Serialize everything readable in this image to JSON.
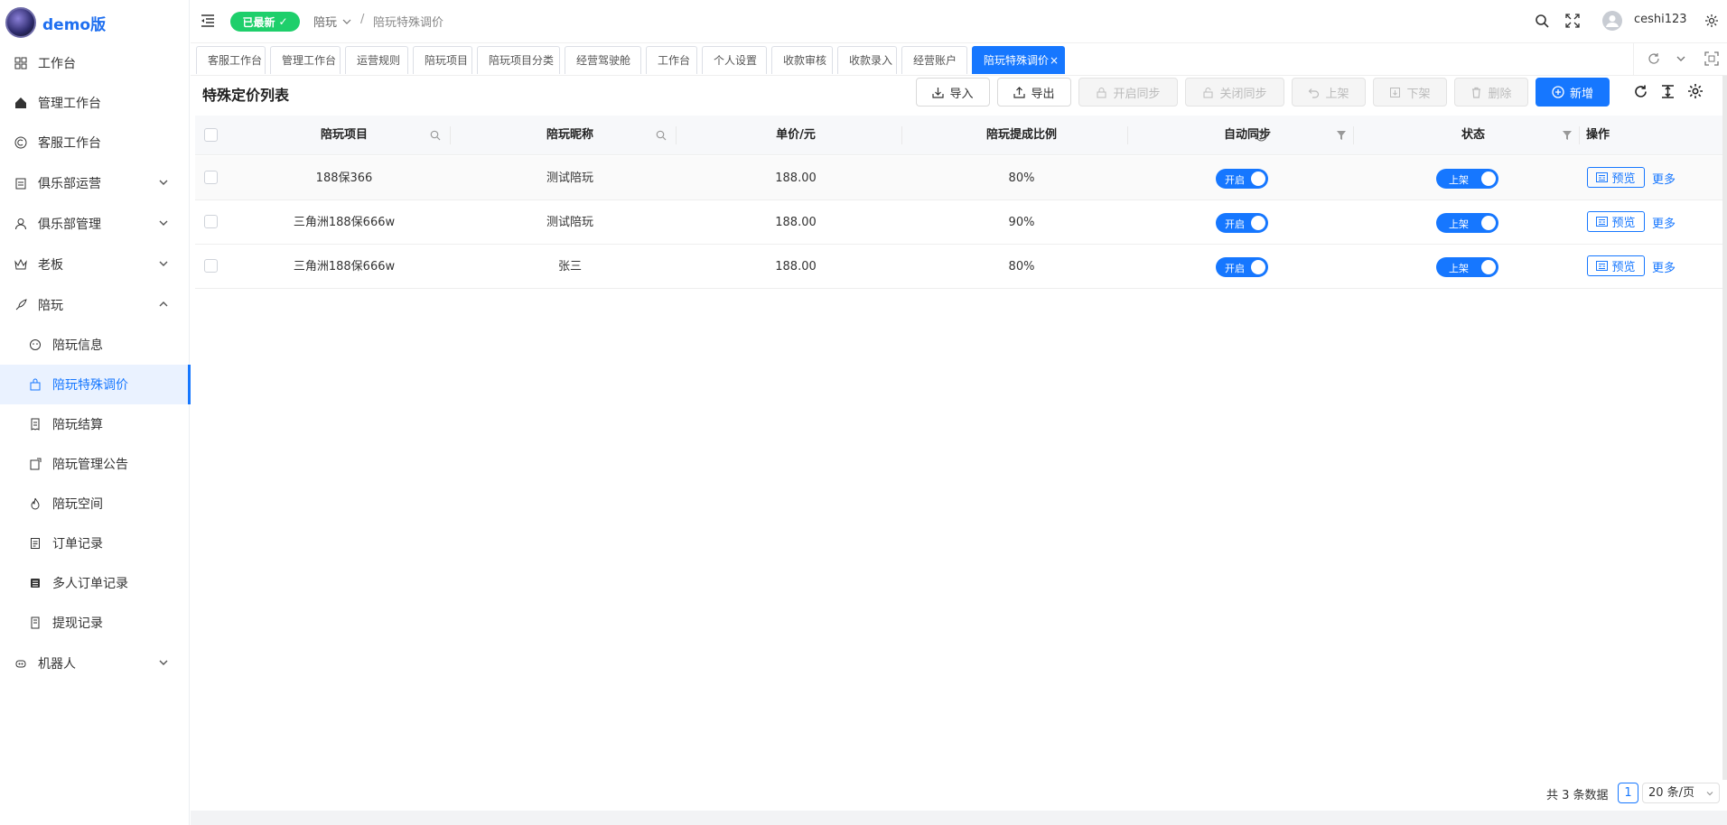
{
  "brand": "demo版",
  "sidebar": {
    "items": [
      {
        "label": "工作台",
        "icon": "dashboard-grid-icon"
      },
      {
        "label": "管理工作台",
        "icon": "home-icon"
      },
      {
        "label": "客服工作台",
        "icon": "copyright-icon"
      },
      {
        "label": "俱乐部运营",
        "icon": "calendar-icon"
      },
      {
        "label": "俱乐部管理",
        "icon": "user-icon"
      },
      {
        "label": "老板",
        "icon": "crown-icon"
      },
      {
        "label": "陪玩",
        "icon": "rocket-icon"
      },
      {
        "label": "陪玩信息",
        "icon": "smile-icon"
      },
      {
        "label": "陪玩特殊调价",
        "icon": "bag-icon"
      },
      {
        "label": "陪玩结算",
        "icon": "receipt-icon"
      },
      {
        "label": "陪玩管理公告",
        "icon": "notice-icon"
      },
      {
        "label": "陪玩空间",
        "icon": "fire-icon"
      },
      {
        "label": "订单记录",
        "icon": "document-icon"
      },
      {
        "label": "多人订单记录",
        "icon": "list-icon"
      },
      {
        "label": "提现记录",
        "icon": "withdraw-icon"
      },
      {
        "label": "机器人",
        "icon": "robot-icon"
      }
    ]
  },
  "header": {
    "badge": "已最新",
    "breadcrumb": [
      "陪玩",
      "/",
      "陪玩特殊调价"
    ],
    "username": "ceshi123"
  },
  "tabs": [
    "客服工作台",
    "管理工作台",
    "运营规则",
    "陪玩项目",
    "陪玩项目分类",
    "经营驾驶舱",
    "工作台",
    "个人设置",
    "收款审核",
    "收款录入",
    "经营账户",
    "陪玩特殊调价"
  ],
  "page": {
    "title": "特殊定价列表"
  },
  "toolbar": {
    "import": "导入",
    "export": "导出",
    "enable_sync": "开启同步",
    "disable_sync": "关闭同步",
    "shelve": "上架",
    "unshelve": "下架",
    "delete": "删除",
    "add": "新增"
  },
  "table": {
    "headers": [
      "陪玩项目",
      "陪玩昵称",
      "单价/元",
      "陪玩提成比例",
      "自动同步",
      "状态",
      "操作"
    ],
    "rows": [
      {
        "item": "188保366",
        "nickname": "测试陪玩",
        "price": "188.00",
        "ratio": "80%",
        "sync": "开启",
        "status": "上架",
        "preview": "预览",
        "more": "更多"
      },
      {
        "item": "三角洲188保666w",
        "nickname": "测试陪玩",
        "price": "188.00",
        "ratio": "90%",
        "sync": "开启",
        "status": "上架",
        "preview": "预览",
        "more": "更多"
      },
      {
        "item": "三角洲188保666w",
        "nickname": "张三",
        "price": "188.00",
        "ratio": "80%",
        "sync": "开启",
        "status": "上架",
        "preview": "预览",
        "more": "更多"
      }
    ]
  },
  "pagination": {
    "total": "共 3 条数据",
    "page": "1",
    "size": "20 条/页"
  },
  "colors": {
    "primary": "#1677ff",
    "badge": "#1ecf6b"
  }
}
